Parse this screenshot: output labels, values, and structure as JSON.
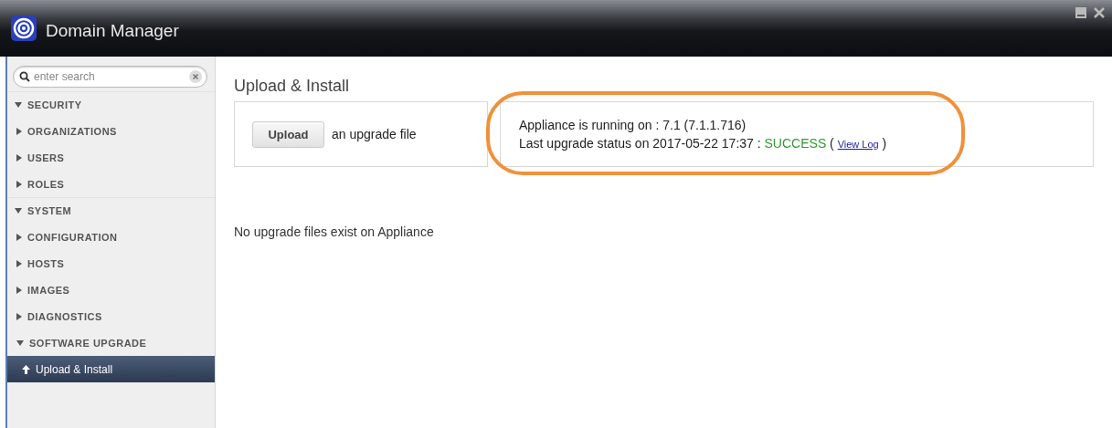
{
  "window": {
    "title": "Domain Manager"
  },
  "sidebar": {
    "search": {
      "placeholder": "enter search"
    },
    "items": [
      {
        "label": "SECURITY",
        "expanded": true,
        "selected": false,
        "children": [
          {
            "label": "ORGANIZATIONS",
            "expanded": false,
            "selected": false
          },
          {
            "label": "USERS",
            "expanded": false,
            "selected": false
          },
          {
            "label": "ROLES",
            "expanded": false,
            "selected": false
          }
        ]
      },
      {
        "label": "SYSTEM",
        "expanded": true,
        "selected": false,
        "children": [
          {
            "label": "CONFIGURATION",
            "expanded": false,
            "selected": false
          },
          {
            "label": "HOSTS",
            "expanded": false,
            "selected": false
          },
          {
            "label": "IMAGES",
            "expanded": false,
            "selected": false
          },
          {
            "label": "DIAGNOSTICS",
            "expanded": false,
            "selected": false
          },
          {
            "label": "SOFTWARE UPGRADE",
            "expanded": true,
            "selected": false,
            "children": [
              {
                "label": "Upload & Install",
                "kind": "page",
                "selected": true
              }
            ]
          }
        ]
      }
    ]
  },
  "main": {
    "heading": "Upload & Install",
    "upload_button": "Upload",
    "upload_caption": "an upgrade file",
    "running": "Appliance is running on : 7.1 (7.1.1.716)",
    "status_prefix": "Last upgrade status on 2017-05-22 17:37 : ",
    "status": "SUCCESS",
    "log_open": "( ",
    "log_link": "View Log",
    "log_close": " )",
    "empty_message": "No upgrade files exist on Appliance"
  }
}
